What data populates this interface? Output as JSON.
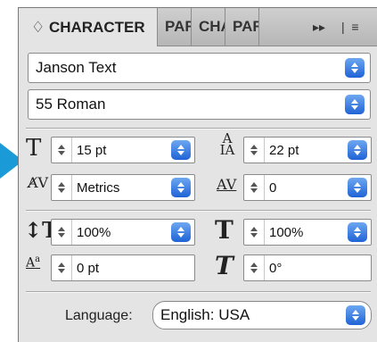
{
  "tabs": {
    "active": "♢ CHARACTER",
    "others": [
      "PAR",
      "CHA",
      "PAR"
    ],
    "forward_icon": "▸▸",
    "menu_icon": "| ≡"
  },
  "font_family": {
    "value": "Janson Text"
  },
  "font_style": {
    "value": "55 Roman"
  },
  "font_size": {
    "value": "15 pt"
  },
  "leading": {
    "value": "22 pt"
  },
  "kerning": {
    "value": "Metrics"
  },
  "tracking": {
    "value": "0"
  },
  "vertical_scale": {
    "value": "100%"
  },
  "horizontal_scale": {
    "value": "100%"
  },
  "baseline_shift": {
    "value": "0 pt"
  },
  "skew": {
    "value": "0°"
  },
  "language": {
    "label": "Language:",
    "value": "English: USA"
  },
  "colors": {
    "accent": "#1f63d6",
    "arrow": "#1a9ad6"
  }
}
